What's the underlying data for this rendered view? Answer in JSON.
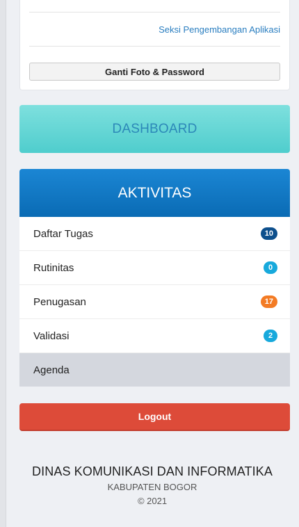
{
  "profile": {
    "section": "Seksi Pengembangan Aplikasi",
    "change_button": "Ganti Foto & Password"
  },
  "dashboard": {
    "label": "DASHBOARD"
  },
  "activity": {
    "title": "AKTIVITAS",
    "items": [
      {
        "label": "Daftar Tugas",
        "badge": "10",
        "badge_color": "#0d4f8c"
      },
      {
        "label": "Rutinitas",
        "badge": "0",
        "badge_color": "#17a9dc"
      },
      {
        "label": "Penugasan",
        "badge": "17",
        "badge_color": "#f37b24"
      },
      {
        "label": "Validasi",
        "badge": "2",
        "badge_color": "#17a9dc"
      },
      {
        "label": "Agenda"
      }
    ]
  },
  "logout": {
    "label": "Logout"
  },
  "footer": {
    "org": "DINAS KOMUNIKASI DAN INFORMATIKA",
    "region": "KABUPATEN BOGOR",
    "copyright": "© 2021"
  }
}
